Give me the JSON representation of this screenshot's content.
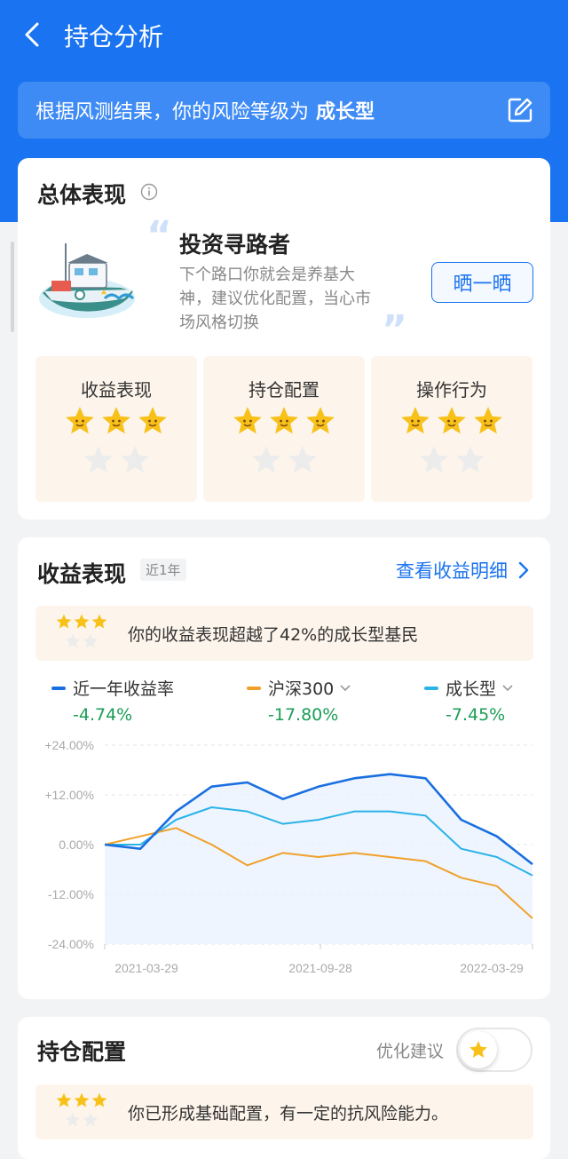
{
  "header": {
    "title": "持仓分析"
  },
  "banner": {
    "text": "根据风测结果，你的风险等级为",
    "level": "成长型"
  },
  "overall": {
    "title": "总体表现",
    "persona": "投资寻路者",
    "description": "下个路口你就会是养基大神，建议优化配置，当心市场风格切换",
    "share_label": "晒一晒",
    "scores": [
      {
        "label": "收益表现",
        "stars": 3,
        "max": 5
      },
      {
        "label": "持仓配置",
        "stars": 3,
        "max": 5
      },
      {
        "label": "操作行为",
        "stars": 3,
        "max": 5
      }
    ]
  },
  "returns": {
    "title": "收益表现",
    "period": "近1年",
    "detail_link": "查看收益明细",
    "summary": "你的收益表现超越了42%的成长型基民",
    "summary_stars": 3,
    "legend": [
      {
        "name": "近一年收益率",
        "value": "-4.74%",
        "color": "#1a6fe0"
      },
      {
        "name": "沪深300",
        "value": "-17.80%",
        "color": "#f0a02a"
      },
      {
        "name": "成长型",
        "value": "-7.45%",
        "color": "#2bb3e6"
      }
    ]
  },
  "chart_data": {
    "type": "line",
    "x_ticks": [
      "2021-03-29",
      "2021-09-28",
      "2022-03-29"
    ],
    "y_ticks": [
      "+24.00%",
      "+12.00%",
      "0.00%",
      "-12.00%",
      "-24.00%"
    ],
    "ylim": [
      -24,
      24
    ],
    "x": [
      "2021-03-29",
      "2021-04-29",
      "2021-05-29",
      "2021-06-28",
      "2021-07-28",
      "2021-08-28",
      "2021-09-28",
      "2021-10-28",
      "2021-11-28",
      "2021-12-28",
      "2022-01-28",
      "2022-02-28",
      "2022-03-29"
    ],
    "series": [
      {
        "name": "近一年收益率",
        "color": "#1a6fe0",
        "values": [
          0,
          -1,
          8,
          14,
          15,
          11,
          14,
          16,
          17,
          16,
          6,
          2,
          -4.74
        ]
      },
      {
        "name": "沪深300",
        "color": "#f0a02a",
        "values": [
          0,
          2,
          4,
          0,
          -5,
          -2,
          -3,
          -2,
          -3,
          -4,
          -8,
          -10,
          -17.8
        ]
      },
      {
        "name": "成长型",
        "color": "#2bb3e6",
        "values": [
          0,
          0,
          6,
          9,
          8,
          5,
          6,
          8,
          8,
          7,
          -1,
          -3,
          -7.45
        ]
      }
    ]
  },
  "holdings": {
    "title": "持仓配置",
    "toggle_label": "优化建议",
    "summary": "你已形成基础配置，有一定的抗风险能力。",
    "summary_stars": 3
  },
  "colors": {
    "brand": "#1a73f0",
    "star": "#f8c11a",
    "star_empty": "#ececec",
    "positive": "#1a9e55"
  }
}
